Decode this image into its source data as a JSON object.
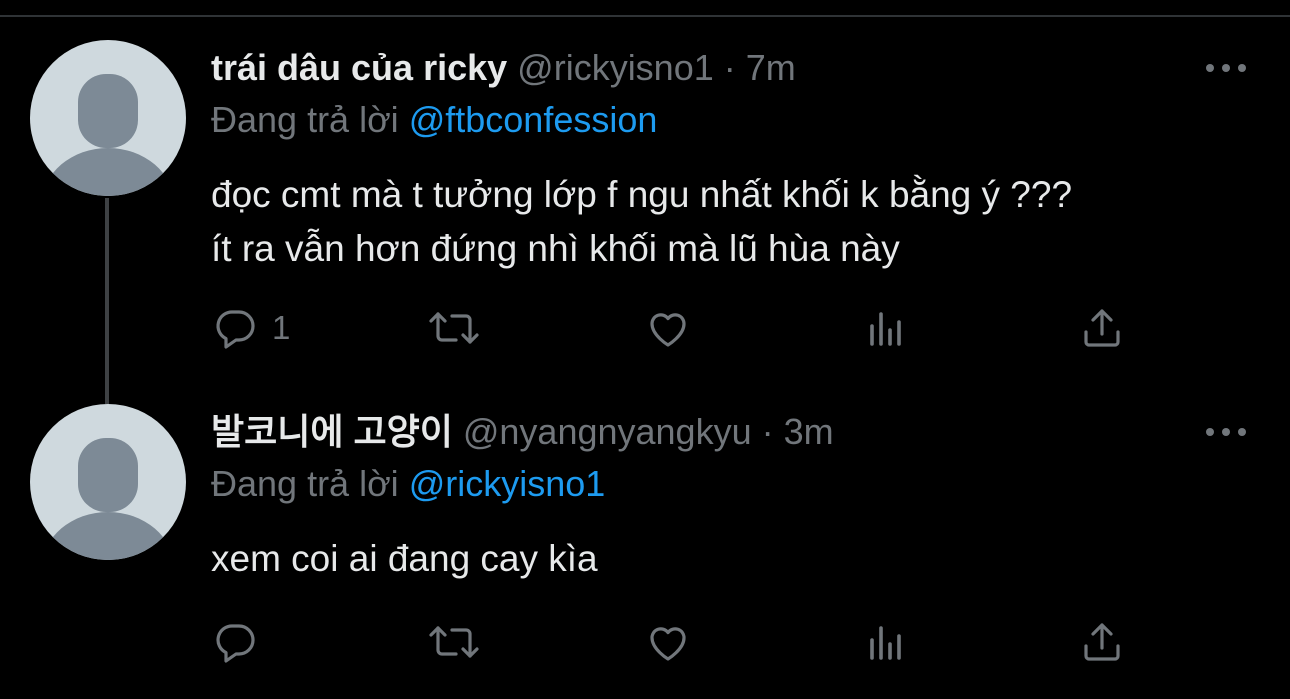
{
  "tweets": [
    {
      "display_name": "trái dâu của ricky",
      "handle": "@rickyisno1",
      "separator": "·",
      "time": "7m",
      "reply_prefix": "Đang trả lời",
      "reply_to": "@ftbconfession",
      "body_lines": [
        "đọc cmt mà t tưởng lớp f ngu nhất khối k bằng ý ???",
        "ít ra vẫn hơn đứng nhì khối mà lũ hùa này"
      ],
      "reply_count": "1",
      "icons": [
        "reply-icon",
        "retweet-icon",
        "like-icon",
        "views-icon",
        "share-icon",
        "more-icon"
      ]
    },
    {
      "display_name": "발코니에 고양이",
      "handle": "@nyangnyangkyu",
      "separator": "·",
      "time": "3m",
      "reply_prefix": "Đang trả lời",
      "reply_to": "@rickyisno1",
      "body_lines": [
        "xem coi ai đang cay kìa"
      ],
      "reply_count": "",
      "icons": [
        "reply-icon",
        "retweet-icon",
        "like-icon",
        "views-icon",
        "share-icon",
        "more-icon"
      ]
    }
  ],
  "colors": {
    "background": "#000000",
    "text": "#e7e9ea",
    "secondary": "#71767b",
    "link": "#1d9bf0",
    "avatar_bg": "#cfd9de",
    "avatar_fg": "#7d8a96",
    "thread_line": "#3e4144"
  }
}
